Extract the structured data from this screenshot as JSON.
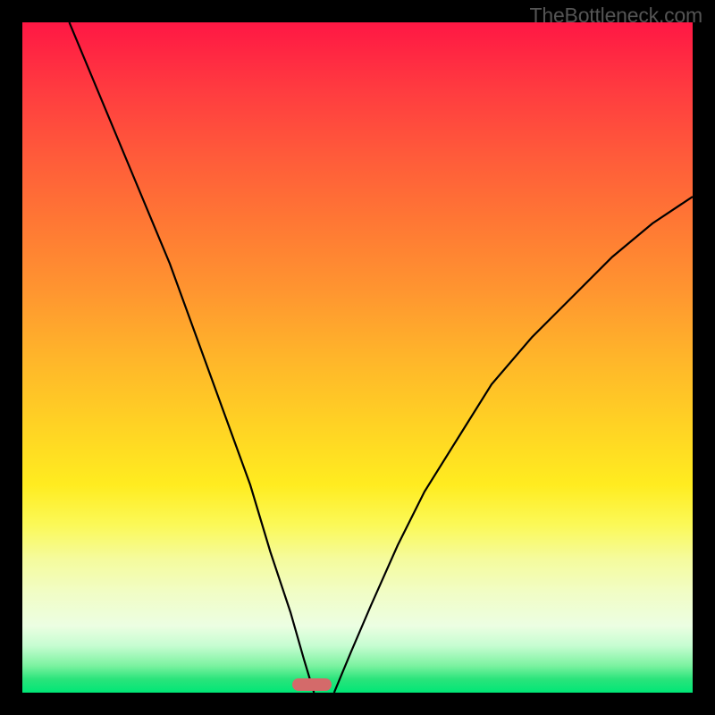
{
  "watermark": "TheBottleneck.com",
  "colors": {
    "frame": "#000000",
    "curve": "#000000",
    "bar": "#d46a6a",
    "watermark": "#555555"
  },
  "chart_data": {
    "type": "line",
    "title": "",
    "xlabel": "",
    "ylabel": "",
    "xlim": [
      0,
      100
    ],
    "ylim": [
      0,
      100
    ],
    "grid": false,
    "legend": false,
    "notch_x": 43,
    "series": [
      {
        "name": "left_branch",
        "x": [
          7,
          12,
          17,
          22,
          26,
          30,
          34,
          37,
          40,
          42,
          43.5
        ],
        "values": [
          100,
          88,
          76,
          64,
          53,
          42,
          31,
          21,
          12,
          5,
          0
        ]
      },
      {
        "name": "right_branch",
        "x": [
          46.5,
          49,
          52,
          56,
          60,
          65,
          70,
          76,
          82,
          88,
          94,
          100
        ],
        "values": [
          0,
          6,
          13,
          22,
          30,
          38,
          46,
          53,
          59,
          65,
          70,
          74
        ]
      }
    ],
    "highlight_bar": {
      "x_start": 41.5,
      "x_end": 47.5,
      "y": 0
    }
  }
}
